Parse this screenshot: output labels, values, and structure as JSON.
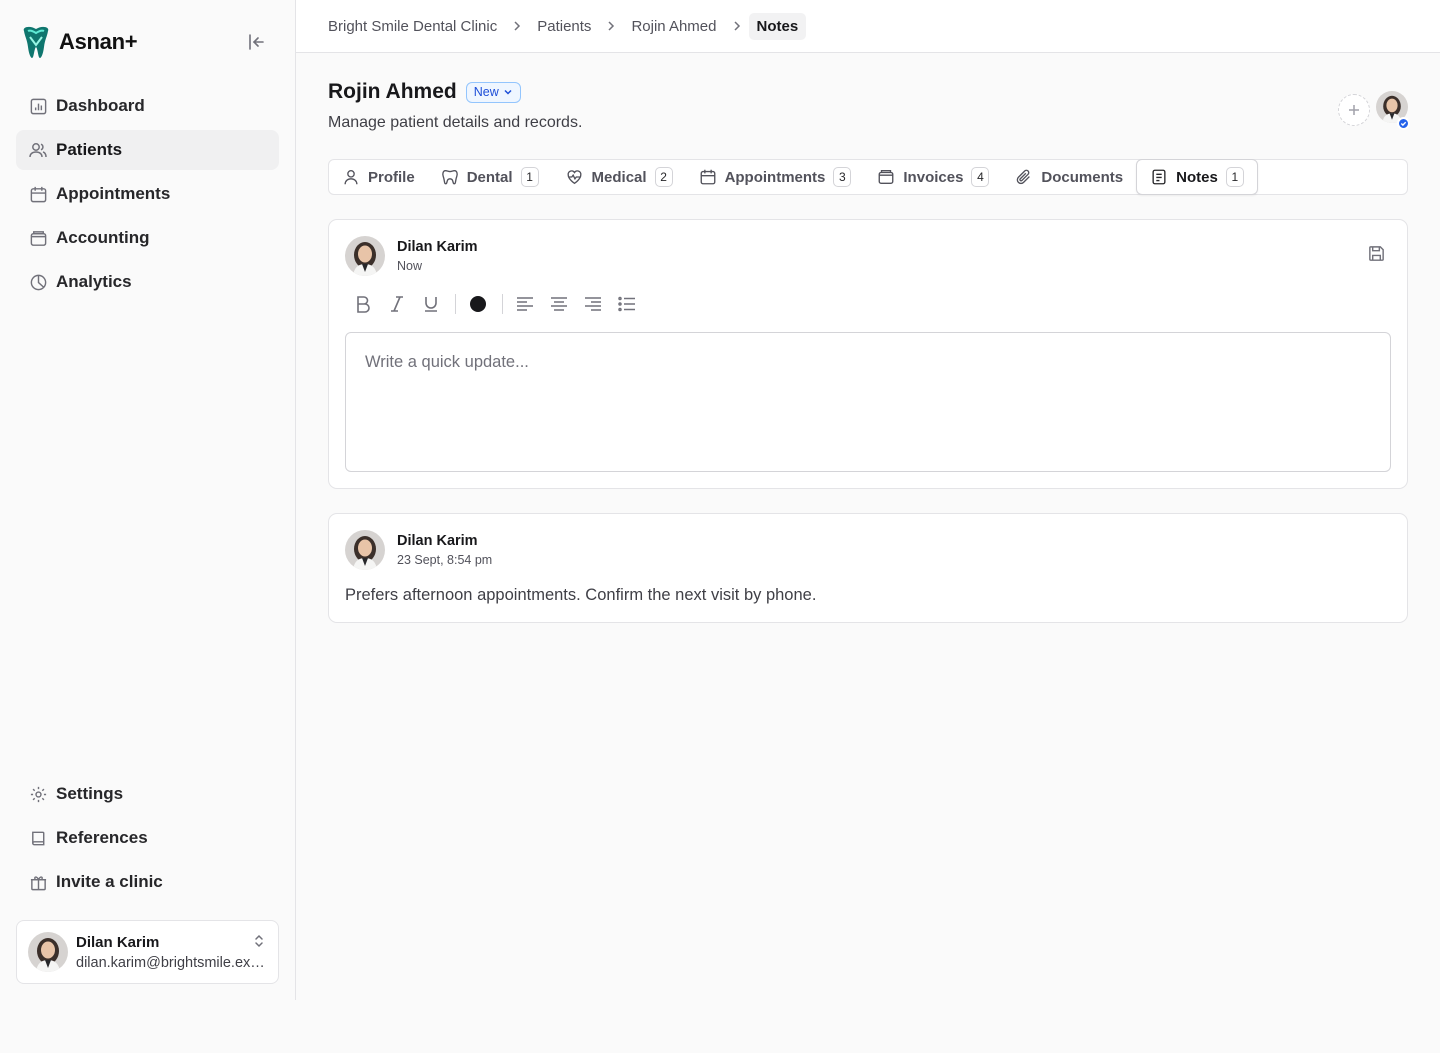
{
  "brand": {
    "name": "Asnan+"
  },
  "sidebar": {
    "items": [
      {
        "label": "Dashboard",
        "icon": "chart-icon"
      },
      {
        "label": "Patients",
        "icon": "users-icon",
        "active": true
      },
      {
        "label": "Appointments",
        "icon": "calendar-icon"
      },
      {
        "label": "Accounting",
        "icon": "wallet-icon"
      },
      {
        "label": "Analytics",
        "icon": "pie-icon"
      }
    ],
    "bottom_items": [
      {
        "label": "Settings",
        "icon": "gear-icon"
      },
      {
        "label": "References",
        "icon": "book-icon"
      },
      {
        "label": "Invite a clinic",
        "icon": "gift-icon"
      }
    ],
    "user": {
      "name": "Dilan Karim",
      "email": "dilan.karim@brightsmile.example.com"
    }
  },
  "breadcrumb": {
    "clinic": "Bright Smile Dental Clinic",
    "patients": "Patients",
    "patient": "Rojin Ahmed",
    "current": "Notes"
  },
  "header": {
    "title": "Rojin Ahmed",
    "badge": "New",
    "subtitle": "Manage patient details and records."
  },
  "tabs": [
    {
      "label": "Profile",
      "count": ""
    },
    {
      "label": "Dental",
      "count": "1"
    },
    {
      "label": "Medical",
      "count": "2"
    },
    {
      "label": "Appointments",
      "count": "3"
    },
    {
      "label": "Invoices",
      "count": "4"
    },
    {
      "label": "Documents",
      "count": ""
    },
    {
      "label": "Notes",
      "count": "1",
      "active": true
    }
  ],
  "composer": {
    "author": "Dilan Karim",
    "time": "Now",
    "placeholder": "Write a quick update...",
    "text_color": "#18181b"
  },
  "notes": [
    {
      "author": "Dilan Karim",
      "time": "23 Sept, 8:54 pm",
      "body": "Prefers afternoon appointments. Confirm the next visit by phone."
    }
  ],
  "colors": {
    "accent_blue": "#2563eb",
    "badge_bg": "#eff6ff",
    "badge_text": "#1d4ed8",
    "logo_teal": "#0f766e"
  }
}
